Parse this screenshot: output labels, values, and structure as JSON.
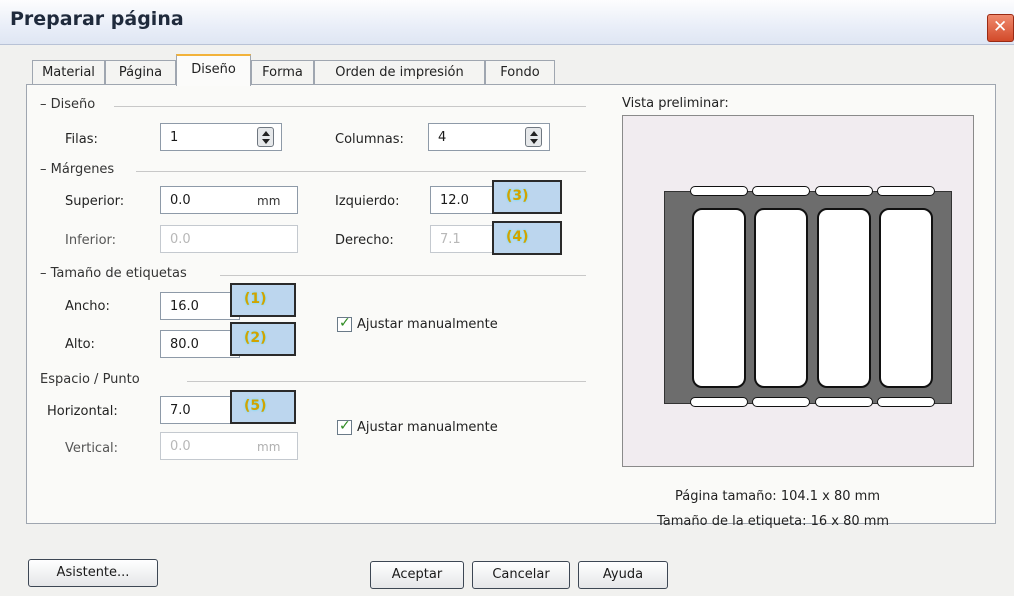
{
  "window": {
    "title": "Preparar página"
  },
  "tabs": [
    {
      "label": "Material"
    },
    {
      "label": "Página"
    },
    {
      "label": "Diseño"
    },
    {
      "label": "Forma"
    },
    {
      "label": "Orden de impresión"
    },
    {
      "label": "Fondo"
    }
  ],
  "diseno": {
    "heading": "Diseño",
    "filas_label": "Filas:",
    "filas_value": "1",
    "columnas_label": "Columnas:",
    "columnas_value": "4"
  },
  "margenes": {
    "heading": "Márgenes",
    "superior_label": "Superior:",
    "superior_value": "0.0",
    "superior_unit": "mm",
    "inferior_label": "Inferior:",
    "inferior_value": "0.0",
    "izquierdo_label": "Izquierdo:",
    "izquierdo_value": "12.0",
    "derecho_label": "Derecho:",
    "derecho_value": "7.1"
  },
  "tamano": {
    "heading": "Tamaño de etiquetas",
    "ancho_label": "Ancho:",
    "ancho_value": "16.0",
    "alto_label": "Alto:",
    "alto_value": "80.0",
    "ajustar_label": "Ajustar manualmente",
    "ajustar_checked": true
  },
  "espacio": {
    "heading": "Espacio / Punto",
    "horizontal_label": "Horizontal:",
    "horizontal_value": "7.0",
    "vertical_label": "Vertical:",
    "vertical_value": "0.0",
    "vertical_unit": "mm",
    "ajustar_label": "Ajustar manualmente",
    "ajustar_checked": true
  },
  "callouts": {
    "c1": "(1)",
    "c2": "(2)",
    "c3": "(3)",
    "c4": "(4)",
    "c5": "(5)"
  },
  "preview": {
    "heading": "Vista preliminar:",
    "pagina_tamano": "Página tamaño:  104.1 x 80  mm",
    "etiqueta_tamano": "Tamaño de la etiqueta:  16 x 80  mm"
  },
  "buttons": {
    "asistente": "Asistente...",
    "aceptar": "Aceptar",
    "cancelar": "Cancelar",
    "ayuda": "Ayuda"
  },
  "colors": {
    "active_tab_accent": "#f2b23a",
    "callout_fill": "#bcd6ee",
    "callout_text": "#d3a300",
    "checkmark": "#2e8b22",
    "close_button": "#d24a2a"
  },
  "icons": {
    "close": "close-icon",
    "spinner": "spinner-icon",
    "checkbox": "checkmark-icon"
  }
}
